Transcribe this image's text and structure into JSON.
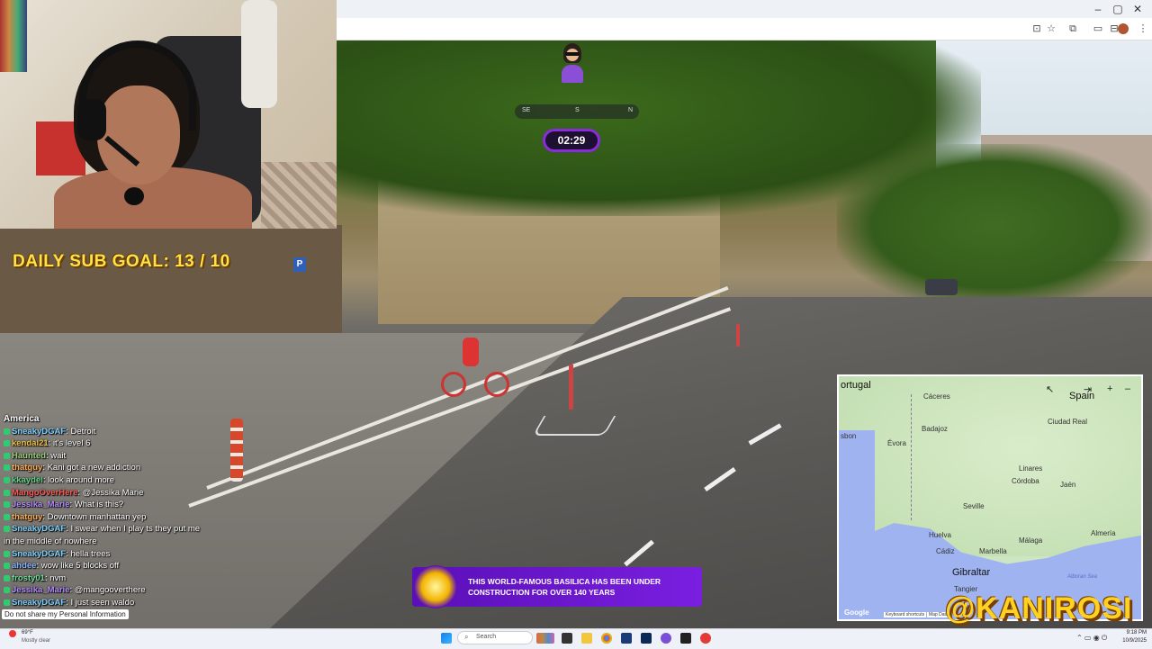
{
  "hud": {
    "timer": "02:29",
    "compass": [
      "SE",
      "S",
      "N"
    ],
    "sub_goal": "DAILY SUB GOAL: 13 / 10"
  },
  "chat": {
    "header": "America",
    "messages": [
      {
        "user": "SneakyDGAF",
        "text": ": Detroit",
        "color": "#7fd1ff"
      },
      {
        "user": "kendal21",
        "text": ": it's level 6",
        "color": "#f0c040"
      },
      {
        "user": "Haunted",
        "text": ": wait",
        "color": "#9ad07a"
      },
      {
        "user": "thatguy",
        "text": ": Kani got a new addiction",
        "color": "#ffae57"
      },
      {
        "user": "kkaydel",
        "text": ": look around more",
        "color": "#63d48a"
      },
      {
        "user": "MangoOverHere",
        "text": ": @Jessika Marie",
        "color": "#ff5a5a"
      },
      {
        "user": "Jessika_Marie",
        "text": ": What is this?",
        "color": "#b48cff"
      },
      {
        "user": "thatguy",
        "text": ": Downtown manhattan yep",
        "color": "#ffae57"
      },
      {
        "user": "SneakyDGAF",
        "text": ": I swear when I play ts they put me in the middle of nowhere",
        "color": "#7fd1ff"
      },
      {
        "user": "SneakyDGAF",
        "text": ": hella trees",
        "color": "#7fd1ff"
      },
      {
        "user": "ahdee",
        "text": ": wow like 5 blocks off",
        "color": "#8ab4ff"
      },
      {
        "user": "frosty01",
        "text": ": nvm",
        "color": "#6fdc9a"
      },
      {
        "user": "Jessika_Marie",
        "text": ": @mangooverthere",
        "color": "#b48cff"
      },
      {
        "user": "SneakyDGAF",
        "text": ": I just seen waldo",
        "color": "#7fd1ff"
      }
    ],
    "privacy_link": "Do not share my Personal Information"
  },
  "map": {
    "labels": [
      {
        "name": "ortugal",
        "class": "big"
      },
      {
        "name": "Spain",
        "class": "big"
      },
      {
        "name": "Cáceres"
      },
      {
        "name": "Badajoz"
      },
      {
        "name": "Évora"
      },
      {
        "name": "sbon"
      },
      {
        "name": "Ciudad Real"
      },
      {
        "name": "Linares"
      },
      {
        "name": "Córdoba"
      },
      {
        "name": "Jaén"
      },
      {
        "name": "Huelva"
      },
      {
        "name": "Seville"
      },
      {
        "name": "Cádiz"
      },
      {
        "name": "Marbella"
      },
      {
        "name": "Málaga"
      },
      {
        "name": "Almería"
      },
      {
        "name": "Gibraltar",
        "class": "big"
      },
      {
        "name": "Tangier"
      },
      {
        "name": "Alboran Sea"
      }
    ],
    "attribution_left": "Google",
    "attribution_shortcuts": "Keyboard shortcuts",
    "attribution_data": "Map Data"
  },
  "hint": {
    "text": "THIS WORLD-FAMOUS BASILICA HAS BEEN UNDER CONSTRUCTION FOR OVER 140 YEARS"
  },
  "watermark": "@KANIROSI",
  "taskbar": {
    "weather_temp": "69°F",
    "weather_desc": "Mostly clear",
    "search_placeholder": "Search",
    "time": "9:18 PM",
    "date": "10/9/2025"
  },
  "colors": {
    "accent": "#8a2be2",
    "hint_bg": "#6a16cc",
    "goal_text": "#ffe14b"
  }
}
